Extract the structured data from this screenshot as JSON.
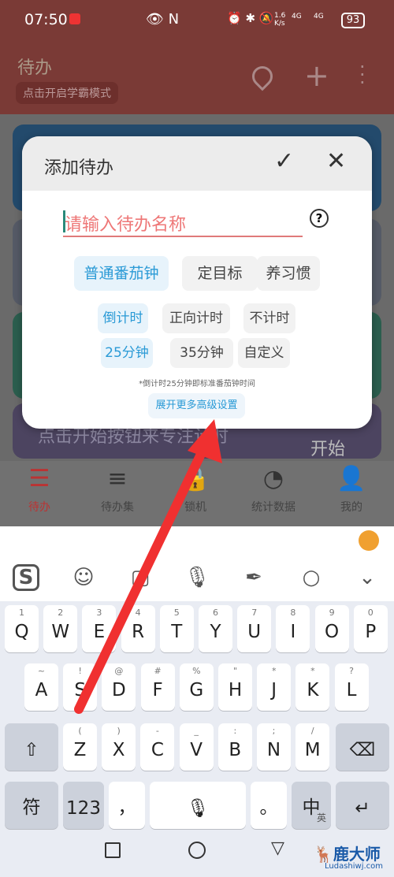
{
  "status_bar": {
    "time": "07:50",
    "speed_top": "1.6",
    "speed_bottom": "K/s",
    "net1": "4G",
    "net2": "4G",
    "battery": "93"
  },
  "header": {
    "title": "待办",
    "study_mode_button": "点击开启学霸模式"
  },
  "background": {
    "card_text": "点击开始按钮来专注计时",
    "start_label": "开始"
  },
  "dialog": {
    "title": "添加待办",
    "name_placeholder": "请输入待办名称",
    "types": [
      {
        "label": "普通番茄钟",
        "selected": true
      },
      {
        "label": "定目标",
        "selected": false
      },
      {
        "label": "养习惯",
        "selected": false
      }
    ],
    "timer_modes": [
      {
        "label": "倒计时",
        "selected": true
      },
      {
        "label": "正向计时",
        "selected": false
      },
      {
        "label": "不计时",
        "selected": false
      }
    ],
    "durations": [
      {
        "label": "25分钟",
        "selected": true
      },
      {
        "label": "35分钟",
        "selected": false
      },
      {
        "label": "自定义",
        "selected": false
      }
    ],
    "hint": "*倒计时25分钟即标准番茄钟时间",
    "advanced_button": "展开更多高级设置"
  },
  "bottom_nav": [
    {
      "label": "待办",
      "active": true
    },
    {
      "label": "待办集"
    },
    {
      "label": "锁机"
    },
    {
      "label": "统计数据"
    },
    {
      "label": "我的"
    }
  ],
  "keyboard": {
    "row1": [
      [
        "Q",
        "1"
      ],
      [
        "W",
        "2"
      ],
      [
        "E",
        "3"
      ],
      [
        "R",
        "4"
      ],
      [
        "T",
        "5"
      ],
      [
        "Y",
        "6"
      ],
      [
        "U",
        "7"
      ],
      [
        "I",
        "8"
      ],
      [
        "O",
        "9"
      ],
      [
        "P",
        "0"
      ]
    ],
    "row2": [
      [
        "A",
        "~"
      ],
      [
        "S",
        "!"
      ],
      [
        "D",
        "@"
      ],
      [
        "F",
        "#"
      ],
      [
        "G",
        "%"
      ],
      [
        "H",
        "\""
      ],
      [
        "J",
        "*"
      ],
      [
        "K",
        "*"
      ],
      [
        "L",
        "?"
      ]
    ],
    "row3": [
      [
        "Z",
        "("
      ],
      [
        "X",
        ")"
      ],
      [
        "C",
        "-"
      ],
      [
        "V",
        "_"
      ],
      [
        "B",
        ":"
      ],
      [
        "N",
        ";"
      ],
      [
        "M",
        "/"
      ]
    ],
    "symbols": "符",
    "numbers": "123",
    "comma": "，",
    "period": "。",
    "lang_main": "中",
    "lang_sub": "英"
  },
  "colors": {
    "accent": "#2a9ad6",
    "active_nav": "#c0392b",
    "annotation_arrow": "#f03030"
  },
  "watermark": {
    "brand": "鹿大师",
    "url": "Ludashiwj.com"
  }
}
